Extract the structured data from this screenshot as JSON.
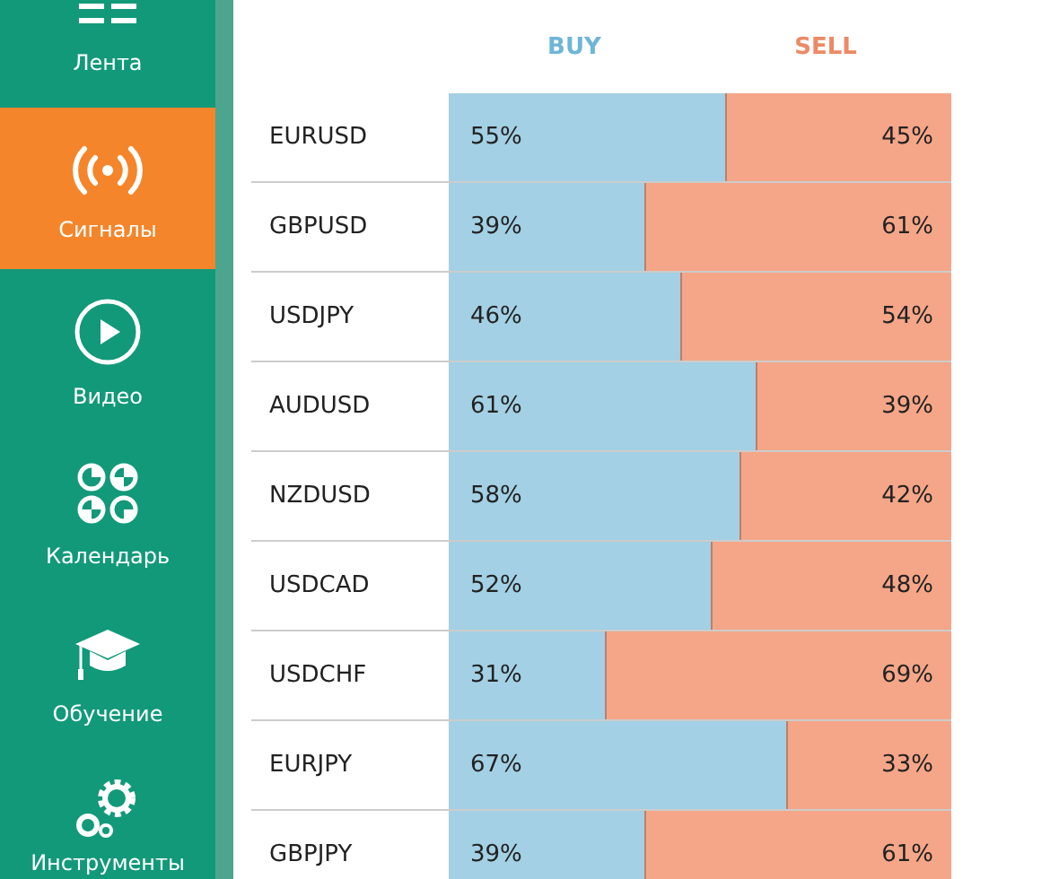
{
  "sidebar": {
    "items": [
      {
        "label": "Лента",
        "selected": false
      },
      {
        "label": "Сигналы",
        "selected": true
      },
      {
        "label": "Видео",
        "selected": false
      },
      {
        "label": "Календарь",
        "selected": false
      },
      {
        "label": "Обучение",
        "selected": false
      },
      {
        "label": "Инструменты",
        "selected": false
      }
    ]
  },
  "table": {
    "columns": [
      "BUY",
      "SELL"
    ],
    "rows": [
      {
        "pair": "EURUSD",
        "level": 0.55,
        "buy": "55%",
        "sell": "45%"
      },
      {
        "pair": "GBPUSD",
        "level": 0.39,
        "buy": "39%",
        "sell": "61%"
      },
      {
        "pair": "USDJPY",
        "level": 0.46,
        "buy": "46%",
        "sell": "54%"
      },
      {
        "pair": "AUDUSD",
        "level": 0.61,
        "buy": "61%",
        "sell": "39%"
      },
      {
        "pair": "NZDUSD",
        "level": 0.58,
        "buy": "58%",
        "sell": "42%"
      },
      {
        "pair": "USDCAD",
        "level": 0.52,
        "buy": "52%",
        "sell": "48%"
      },
      {
        "pair": "USDCHF",
        "level": 0.31,
        "buy": "31%",
        "sell": "69%"
      },
      {
        "pair": "EURJPY",
        "level": 0.67,
        "buy": "67%",
        "sell": "33%"
      },
      {
        "pair": "GBPJPY",
        "level": 0.39,
        "buy": "39%",
        "sell": "61%"
      }
    ]
  }
}
